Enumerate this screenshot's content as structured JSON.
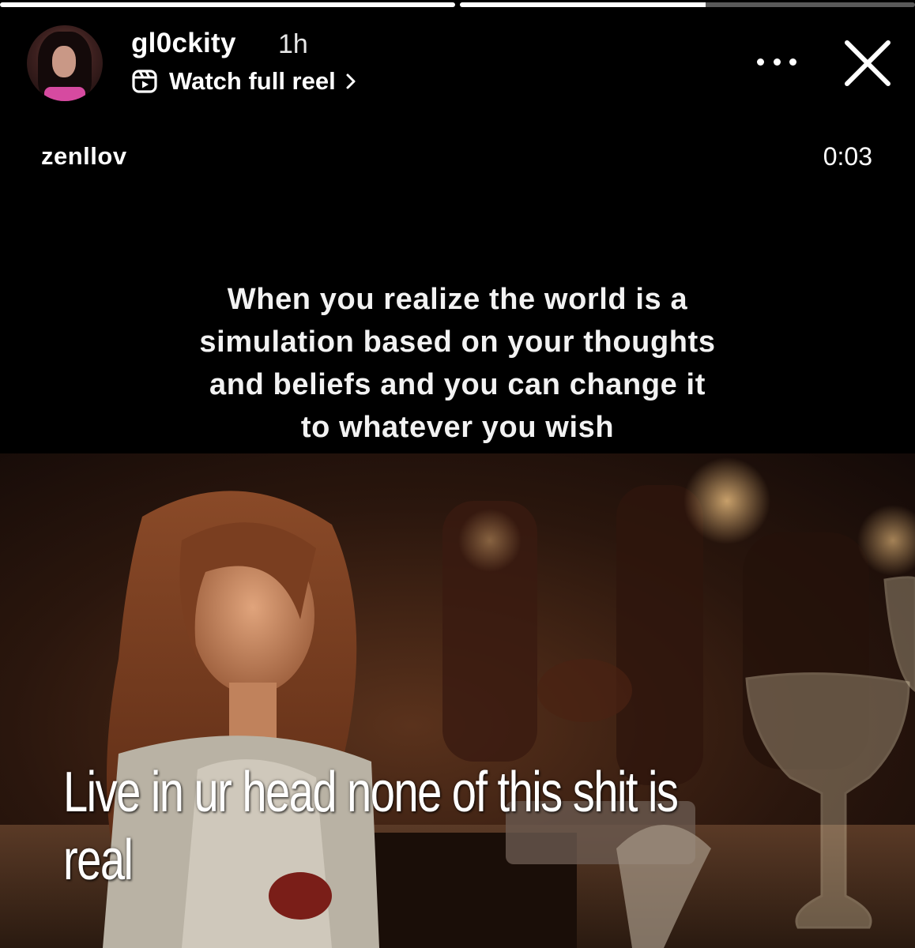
{
  "story": {
    "progress": [
      1.0,
      0.54
    ]
  },
  "header": {
    "username": "gl0ckity",
    "time": "1h",
    "reel_link": "Watch full reel",
    "more_icon": "more-horizontal-icon",
    "close_icon": "close-icon"
  },
  "reel": {
    "author": "zenllov",
    "duration": "0:03",
    "caption_lines": [
      "When you realize the world is a",
      "simulation based on your thoughts",
      "and beliefs and you can change it",
      "to whatever you wish"
    ],
    "overlay_lines": [
      "Live in ur head none of this shit is",
      "real"
    ]
  },
  "colors": {
    "background": "#000000",
    "text": "#ffffff",
    "scene_warm": "#6b3a20"
  }
}
